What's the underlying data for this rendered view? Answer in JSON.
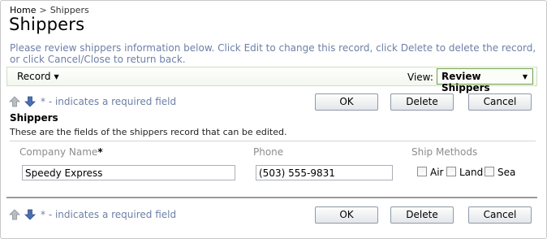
{
  "breadcrumb": {
    "home": "Home",
    "separator": ">",
    "current": "Shippers"
  },
  "page": {
    "title": "Shippers",
    "description": "Please review shippers information below. Click Edit to change this record, click Delete to delete the record, or click Cancel/Close to return back."
  },
  "action_bar": {
    "record_menu": "Record",
    "view_label": "View:",
    "view_selected": "Review Shippers"
  },
  "form_toolbar": {
    "required_note": "* - indicates a required field",
    "ok_label": "OK",
    "delete_label": "Delete",
    "cancel_label": "Cancel"
  },
  "section": {
    "title": "Shippers",
    "description": "These are the fields of the shippers record that can be edited."
  },
  "fields": {
    "company_name": {
      "label": "Company Name",
      "required_mark": "*",
      "value": "Speedy Express"
    },
    "phone": {
      "label": "Phone",
      "value": "(503) 555-9831"
    },
    "ship_methods": {
      "label": "Ship Methods",
      "options": [
        {
          "label": "Air",
          "checked": false
        },
        {
          "label": "Land",
          "checked": false
        },
        {
          "label": "Sea",
          "checked": false
        }
      ]
    }
  },
  "icons": {
    "move_up": "arrow-up-icon",
    "move_down": "arrow-down-icon"
  },
  "colors": {
    "description_text": "#6e7fa6",
    "view_border": "#6fa14a"
  }
}
